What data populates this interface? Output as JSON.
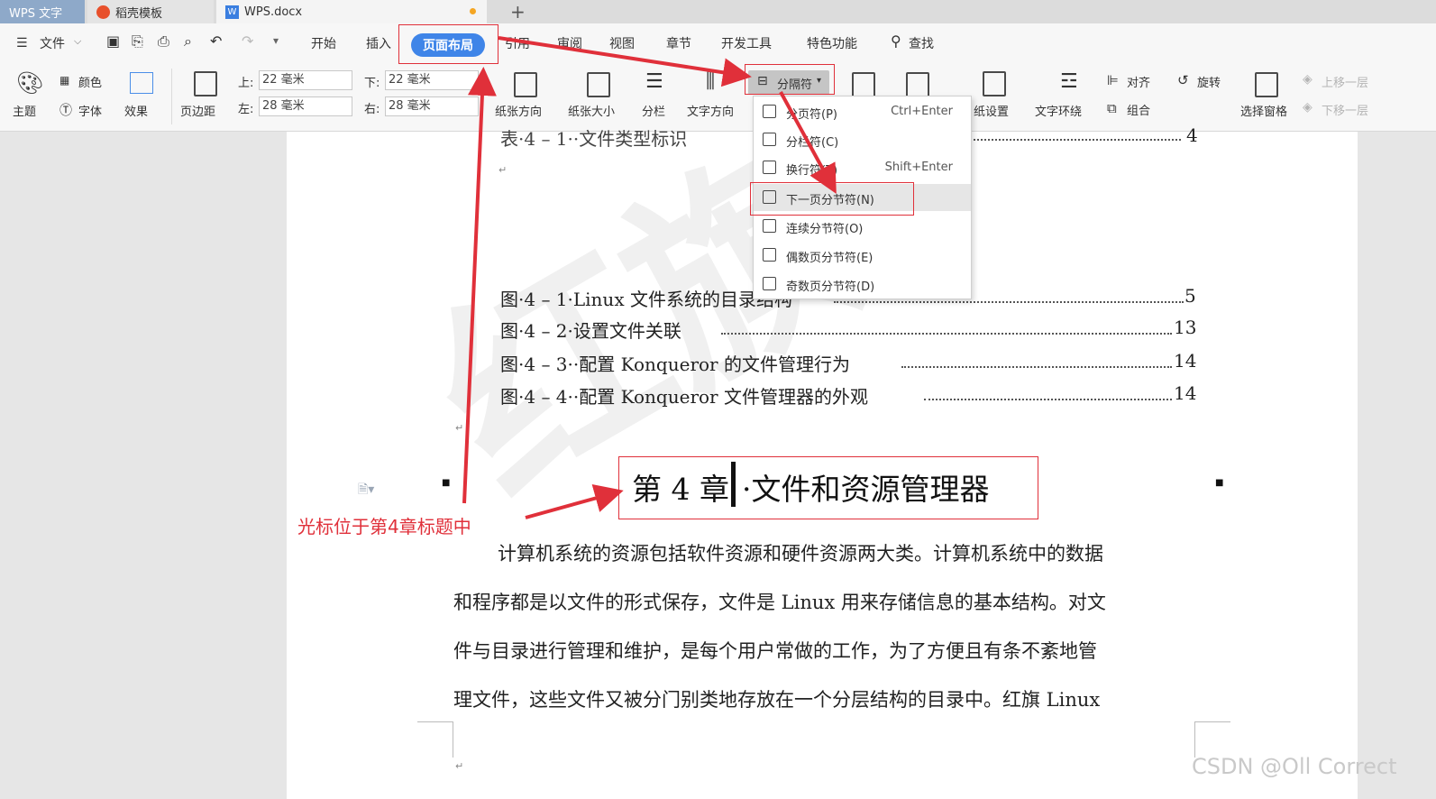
{
  "tabs": {
    "app": "WPS 文字",
    "templates": "稻壳模板",
    "doc": "WPS.docx",
    "new_tab": "+"
  },
  "menu": {
    "file": "文件",
    "items": [
      "开始",
      "插入",
      "页面布局",
      "引用",
      "审阅",
      "视图",
      "章节",
      "开发工具",
      "特色功能"
    ],
    "active": "页面布局",
    "search": "查找"
  },
  "ribbon": {
    "theme": "主题",
    "color": "颜色",
    "font": "字体",
    "effect": "效果",
    "margins": "页边距",
    "top_label": "上:",
    "top_value": "22 毫米",
    "bottom_label": "下:",
    "bottom_value": "22 毫米",
    "left_label": "左:",
    "left_value": "28 毫米",
    "right_label": "右:",
    "right_value": "28 毫米",
    "orientation": "纸张方向",
    "size": "纸张大小",
    "columns": "分栏",
    "text_direction": "文字方向",
    "separator": "分隔符",
    "paper_settings": "纸设置",
    "wrap": "文字环绕",
    "align": "对齐",
    "rotate": "旋转",
    "group": "组合",
    "selection_pane": "选择窗格",
    "bring_forward": "上移一层",
    "send_backward": "下移一层"
  },
  "dropdown": {
    "items": [
      {
        "label": "分页符(P)",
        "shortcut": "Ctrl+Enter"
      },
      {
        "label": "分栏符(C)",
        "shortcut": ""
      },
      {
        "label": "换行符(T)",
        "shortcut": "Shift+Enter"
      },
      {
        "label": "下一页分节符(N)",
        "shortcut": ""
      },
      {
        "label": "连续分节符(O)",
        "shortcut": ""
      },
      {
        "label": "偶数页分节符(E)",
        "shortcut": ""
      },
      {
        "label": "奇数页分节符(D)",
        "shortcut": ""
      }
    ]
  },
  "document": {
    "toc_top": "表·4 – 1··文件类型标识",
    "toc_top_page": "4",
    "figures": [
      {
        "label": "图·4 – 1·Linux 文件系统的目录结构",
        "page": "5"
      },
      {
        "label": "图·4 – 2·设置文件关联",
        "page": "13"
      },
      {
        "label": "图·4 – 3··配置 Konqueror 的文件管理行为",
        "page": "14"
      },
      {
        "label": "图·4 – 4··配置 Konqueror 文件管理器的外观",
        "page": "14"
      }
    ],
    "heading_part1": "第 4 章",
    "heading_part2": "·文件和资源管理器",
    "paragraph": [
      "计算机系统的资源包括软件资源和硬件资源两大类。计算机系统中的数据",
      "和程序都是以文件的形式保存，文件是 Linux 用来存储信息的基本结构。对文",
      "件与目录进行管理和维护，是每个用户常做的工作，为了方便且有条不紊地管",
      "理文件，这些文件又被分门别类地存放在一个分层结构的目录中。红旗 Linux"
    ],
    "watermark": "红旗"
  },
  "annotation": "光标位于第4章标题中",
  "credit": "CSDN @Oll Correct",
  "colors": {
    "accent": "#3f85e8",
    "annotation_red": "#e0303a"
  }
}
